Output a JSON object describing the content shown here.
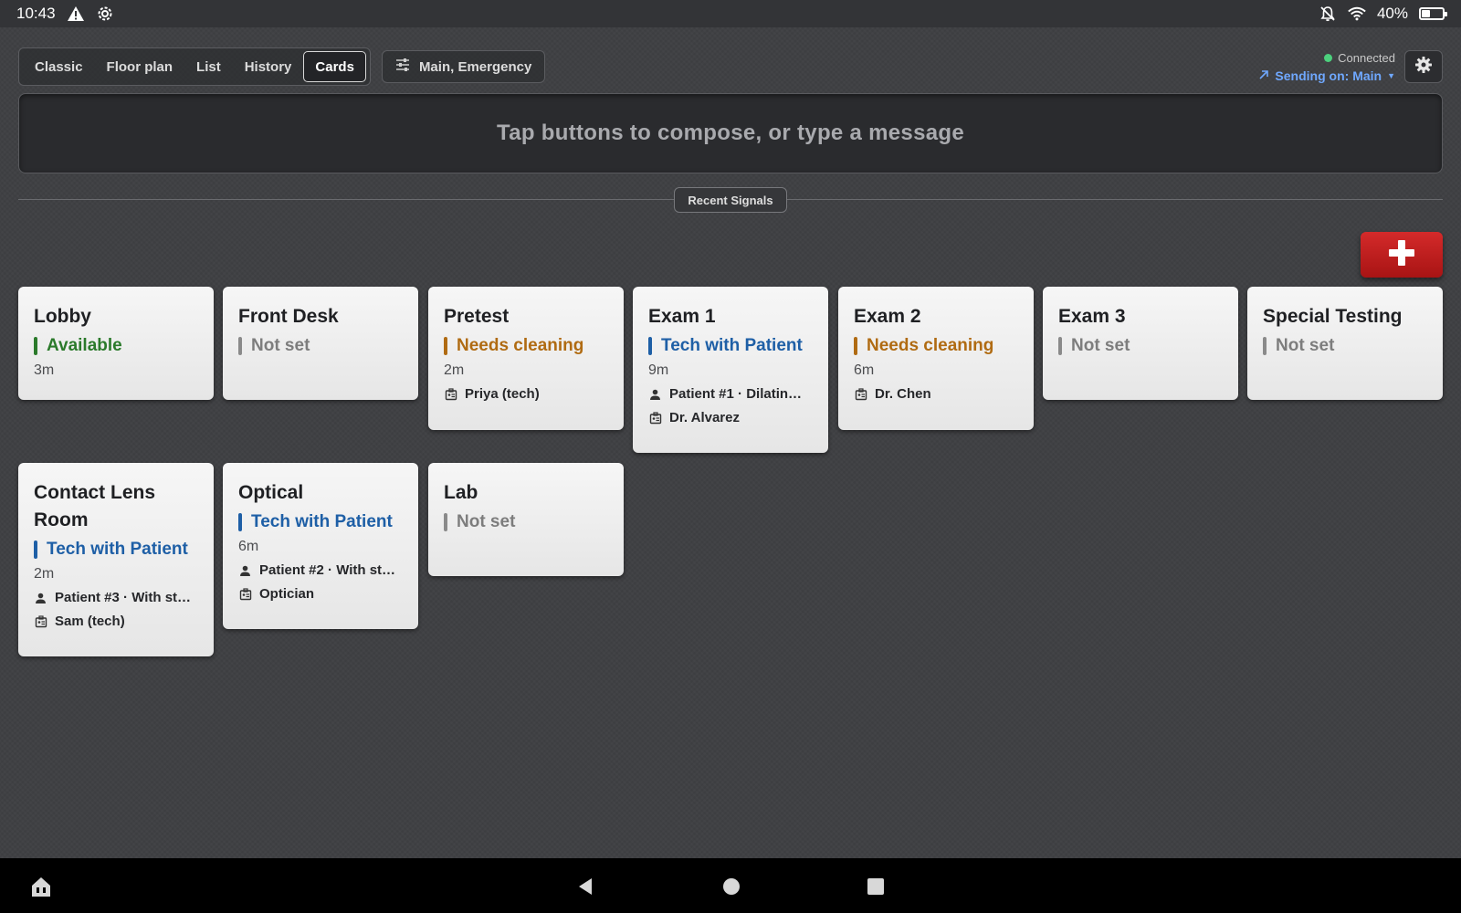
{
  "status_bar": {
    "time": "10:43",
    "left_icons": [
      "warning-icon",
      "settings-icon"
    ],
    "right_icons": [
      "notifications-off-icon",
      "wifi-icon",
      "battery-icon"
    ],
    "battery": "40%",
    "battery_level": 0.4
  },
  "toolbar": {
    "tabs": [
      {
        "label": "Classic"
      },
      {
        "label": "Floor plan"
      },
      {
        "label": "List"
      },
      {
        "label": "History"
      },
      {
        "label": "Cards",
        "active": true
      }
    ],
    "filter_label": "Main, Emergency",
    "connection_status": "Connected",
    "sending_label": "Sending on: Main",
    "settings_icon": "gear-icon"
  },
  "compose": {
    "placeholder": "Tap buttons to compose, or type a message"
  },
  "recent_signals_label": "Recent Signals",
  "emergency_icon": "plus-icon",
  "colors": {
    "available": "#2b7a2b",
    "not_set": "#7d7d7d",
    "needs_cleaning": "#b06b12",
    "tech_with_patient": "#1e5fa6",
    "emergency": "#c81e1e",
    "connected": "#4cd07d",
    "link": "#6fa8ff"
  },
  "rooms": [
    {
      "name": "Lobby",
      "status": "Available",
      "elapsed": "3m"
    },
    {
      "name": "Front Desk",
      "status": "Not set"
    },
    {
      "name": "Pretest",
      "status": "Needs cleaning",
      "elapsed": "2m",
      "staff": "Priya (tech)"
    },
    {
      "name": "Exam 1",
      "status": "Tech with Patient",
      "elapsed": "9m",
      "patient": "Patient #1 · Dilatin…",
      "staff": "Dr. Alvarez"
    },
    {
      "name": "Exam 2",
      "status": "Needs cleaning",
      "elapsed": "6m",
      "staff": "Dr. Chen"
    },
    {
      "name": "Exam 3",
      "status": "Not set"
    },
    {
      "name": "Special Testing",
      "status": "Not set"
    },
    {
      "name": "Contact Lens Room",
      "status": "Tech with Patient",
      "elapsed": "2m",
      "patient": "Patient #3 · With st…",
      "staff": "Sam (tech)"
    },
    {
      "name": "Optical",
      "status": "Tech with Patient",
      "elapsed": "6m",
      "patient": "Patient #2 · With st…",
      "staff": "Optician"
    },
    {
      "name": "Lab",
      "status": "Not set"
    }
  ],
  "nav_bar": {
    "icons": [
      "home-icon",
      "back-icon",
      "home-circle-icon",
      "recents-icon"
    ]
  }
}
